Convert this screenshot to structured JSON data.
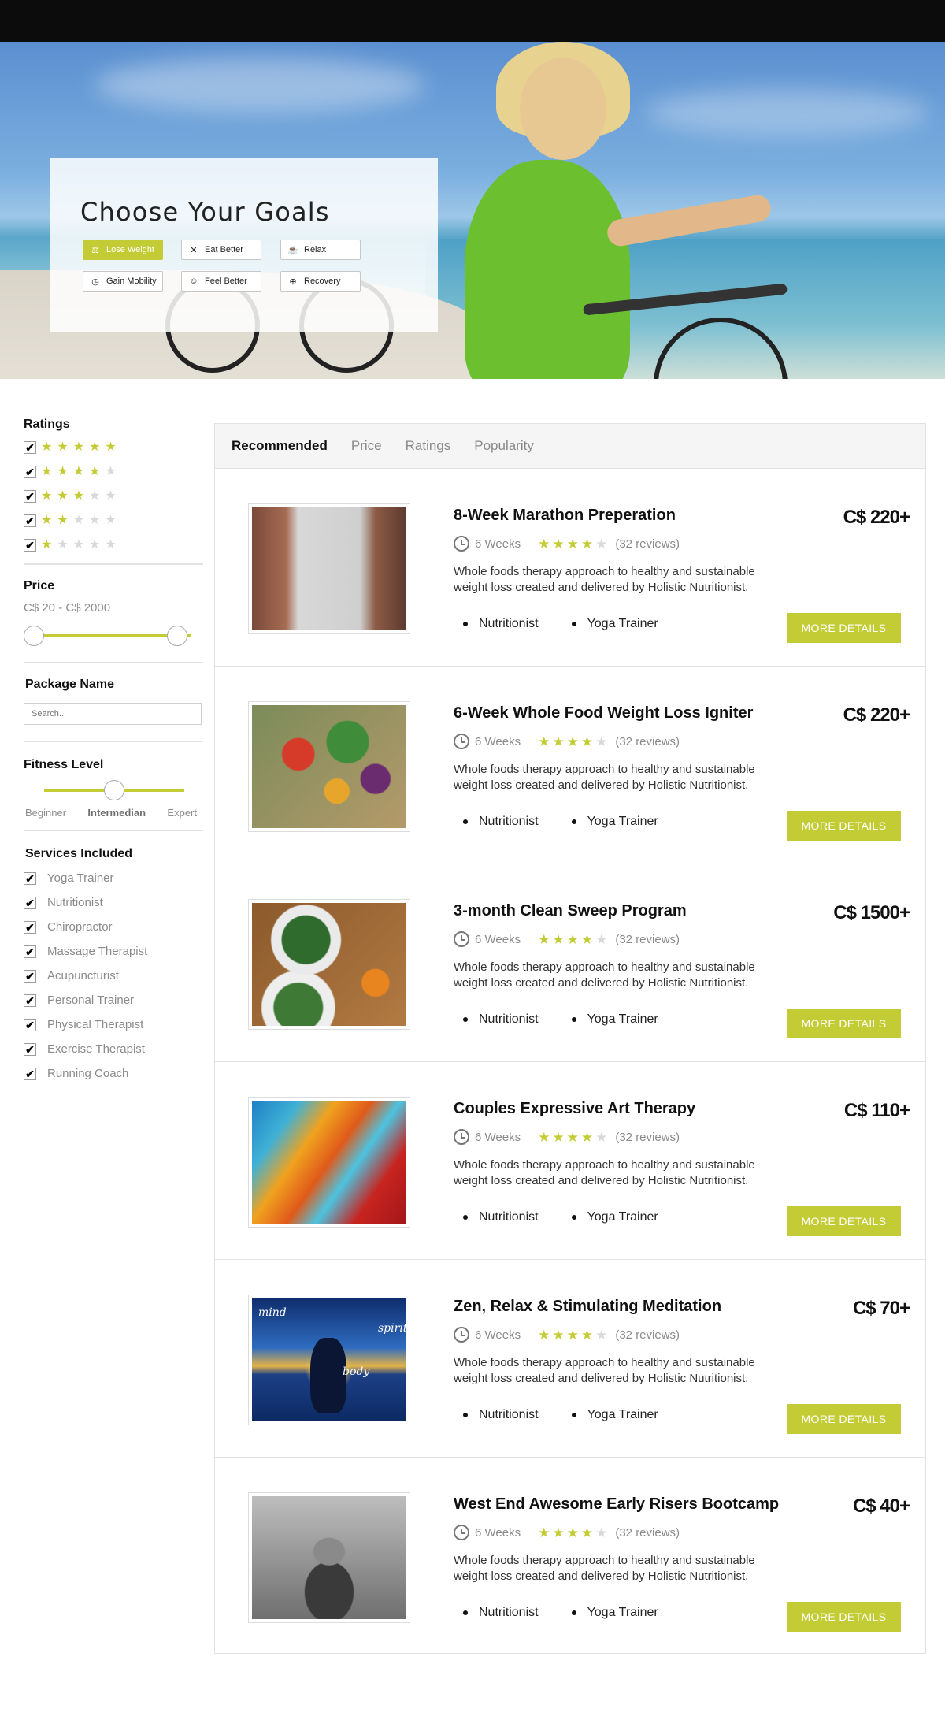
{
  "hero": {
    "title": "Choose Your Goals",
    "goals": [
      {
        "label": "Lose Weight",
        "icon": "scale-icon",
        "active": true
      },
      {
        "label": "Eat Better",
        "icon": "utensils-icon",
        "active": false
      },
      {
        "label": "Relax",
        "icon": "coffee-cup-icon",
        "active": false
      },
      {
        "label": "Gain Mobility",
        "icon": "stopwatch-icon",
        "active": false
      },
      {
        "label": "Feel Better",
        "icon": "smiley-icon",
        "active": false
      },
      {
        "label": "Recovery",
        "icon": "plus-circle-icon",
        "active": false
      }
    ]
  },
  "sidebar": {
    "ratings_title": "Ratings",
    "ratings": [
      5,
      4,
      3,
      2,
      1
    ],
    "price_title": "Price",
    "price_range": "C$ 20 - C$ 2000",
    "package_title": "Package Name",
    "package_placeholder": "Search...",
    "fitness_title": "Fitness Level",
    "levels": [
      "Beginner",
      "Intermedian",
      "Expert"
    ],
    "selected_level": "Intermedian",
    "services_title": "Services Included",
    "services": [
      "Yoga Trainer",
      "Nutritionist",
      "Chiropractor",
      "Massage Therapist",
      "Acupuncturist",
      "Personal Trainer",
      "Physical Therapist",
      "Exercise Therapist",
      "Running Coach"
    ]
  },
  "tabs": [
    "Recommended",
    "Price",
    "Ratings",
    "Popularity"
  ],
  "active_tab": "Recommended",
  "items": [
    {
      "title": "8-Week Marathon Preperation",
      "price": "C$ 220+",
      "duration": "6 Weeks",
      "rating": 4,
      "reviews": "(32 reviews)",
      "desc": "Whole foods therapy approach to healthy and sustainable weight loss created and delivered by Holistic Nutritionist.",
      "tags": [
        "Nutritionist",
        "Yoga Trainer"
      ],
      "button": "MORE DETAILS",
      "image": "runner-photo"
    },
    {
      "title": "6-Week Whole Food Weight Loss Igniter",
      "price": "C$ 220+",
      "duration": "6 Weeks",
      "rating": 4,
      "reviews": "(32 reviews)",
      "desc": "Whole foods therapy approach to healthy and sustainable weight loss created and delivered by Holistic Nutritionist.",
      "tags": [
        "Nutritionist",
        "Yoga Trainer"
      ],
      "button": "MORE DETAILS",
      "image": "vegetables-photo"
    },
    {
      "title": "3-month Clean Sweep Program",
      "price": "C$ 1500+",
      "duration": "6 Weeks",
      "rating": 4,
      "reviews": "(32 reviews)",
      "desc": "Whole foods therapy approach to healthy and sustainable weight loss created and delivered by Holistic Nutritionist.",
      "tags": [
        "Nutritionist",
        "Yoga Trainer"
      ],
      "button": "MORE DETAILS",
      "image": "salad-photo"
    },
    {
      "title": "Couples Expressive Art Therapy",
      "price": "C$ 110+",
      "duration": "6 Weeks",
      "rating": 4,
      "reviews": "(32 reviews)",
      "desc": "Whole foods therapy approach to healthy and sustainable weight loss created and delivered by Holistic Nutritionist.",
      "tags": [
        "Nutritionist",
        "Yoga Trainer"
      ],
      "button": "MORE DETAILS",
      "image": "paint-photo"
    },
    {
      "title": "Zen, Relax & Stimulating Meditation",
      "price": "C$ 70+",
      "duration": "6 Weeks",
      "rating": 4,
      "reviews": "(32 reviews)",
      "desc": "Whole foods therapy approach to healthy and sustainable weight loss created and delivered by Holistic Nutritionist.",
      "tags": [
        "Nutritionist",
        "Yoga Trainer"
      ],
      "button": "MORE DETAILS",
      "image": "meditation-photo",
      "image_words": [
        "mind",
        "spirit",
        "body"
      ]
    },
    {
      "title": "West End Awesome Early Risers Bootcamp",
      "price": "C$ 40+",
      "duration": "6 Weeks",
      "rating": 4,
      "reviews": "(32 reviews)",
      "desc": "Whole foods therapy approach to healthy and sustainable weight loss created and delivered by Holistic Nutritionist.",
      "tags": [
        "Nutritionist",
        "Yoga Trainer"
      ],
      "button": "MORE DETAILS",
      "image": "bootcamp-photo"
    }
  ],
  "colors": {
    "accent": "#c4cc35",
    "topbar": "#0c0c0d",
    "star_off": "#d9d9d9"
  }
}
